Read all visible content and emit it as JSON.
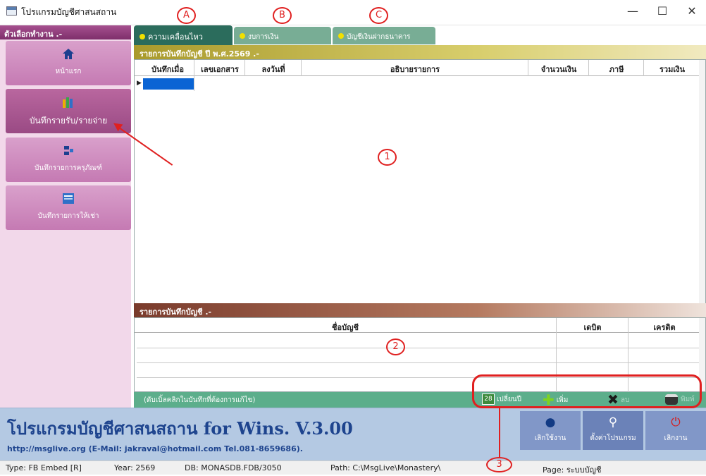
{
  "window": {
    "title": "โปรแกรมบัญชีศาสนสถาน",
    "minimize": "—",
    "maximize": "☐",
    "close": "✕"
  },
  "sidebar": {
    "header": "ตัวเลือกทำงาน .-",
    "items": [
      {
        "label": "หน้าแรก",
        "icon": "home-icon"
      },
      {
        "label": "บันทึกรายรับ/รายจ่าย",
        "icon": "books-icon"
      },
      {
        "label": "บันทึกรายการครุภัณฑ์",
        "icon": "equipment-icon"
      },
      {
        "label": "บันทึกรายการให้เช่า",
        "icon": "news-icon"
      }
    ]
  },
  "tabs": [
    {
      "label": "ความเคลื่อนไหว"
    },
    {
      "label": "งบการเงิน"
    },
    {
      "label": "บัญชีเงินฝากธนาคาร"
    }
  ],
  "journal": {
    "title": "รายการบันทึกบัญชี ปี พ.ศ.2569 .-",
    "columns": [
      "บันทึกเมื่อ",
      "เลขเอกสาร",
      "ลงวันที่",
      "อธิบายรายการ",
      "จำนวนเงิน",
      "ภาษี",
      "รวมเงิน"
    ]
  },
  "entries": {
    "title": "รายการบันทึกบัญชี .-",
    "columns": [
      "ชื่อบัญชี",
      "เดบิต",
      "เครดิต"
    ]
  },
  "toolbar": {
    "note": "(ดับเบิ้ลคลิกในบันทึกที่ต้องการแก้ไข)",
    "change_year": "เปลี่ยนปี",
    "calendar_day": "28",
    "add": "เพิ่ม",
    "delete": "ลบ",
    "print": "พิมพ์"
  },
  "footer": {
    "brand": "โปรแกรมบัญชีศาสนสถาน for Wins. V.3.00",
    "contact": "http://msglive.org (E-Mail: jakraval@hotmail.com Tel.081-8659686).",
    "logout": "เลิกใช้งาน",
    "settings": "ตั้งค่าโปรแกรม",
    "exit": "เลิกงาน"
  },
  "statusbar": {
    "type": "Type: FB Embed [R]",
    "year": "Year: 2569",
    "db": "DB: MONASDB.FDB/3050",
    "path": "Path: C:\\MsgLive\\Monastery\\",
    "page": "Page: ระบบบัญชี"
  },
  "annotations": {
    "a": "A",
    "b": "B",
    "c": "C",
    "n1": "1",
    "n2": "2",
    "n3": "3"
  },
  "colors": {
    "accent": "#2b6c5c",
    "sidebar": "#c57ab3",
    "footer": "#b4c9e3",
    "annotation": "#e02020"
  }
}
